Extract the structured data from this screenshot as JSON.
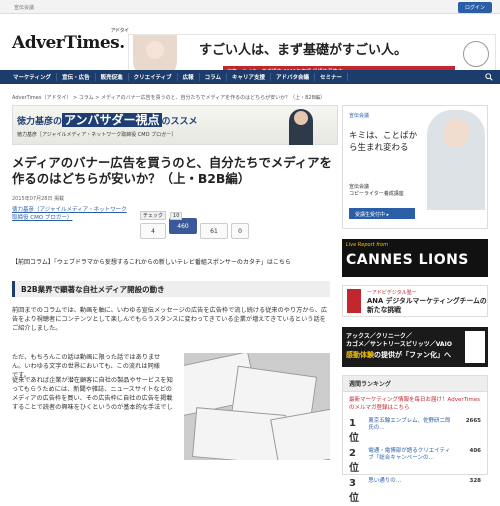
{
  "top": {
    "site": "宣伝会議",
    "login": "ログイン"
  },
  "header": {
    "logo": "AdverTimes.",
    "logo_ruby": "アドタイ"
  },
  "banner": {
    "catch": "すごい人は、まず基礎がすごい人。",
    "sub": "編集・ライター養成講座 2015年春期 受講生募集中"
  },
  "nav": [
    "マーケティング",
    "宣伝・広告",
    "販売促進",
    "クリエイティブ",
    "広報",
    "コラム",
    "キャリア支援",
    "アドバタ会議",
    "セミナー"
  ],
  "breadcrumb": "AdverTimes（アドタイ） > コラム > メディアのバナー広告を買うのと、自分たちでメディアを作るのはどちらが安いか？（上・B2B編）",
  "series_banner": {
    "title_a": "徳力基彦の",
    "title_em": "アンバサダー視点",
    "title_b": "のススメ",
    "sub": "徳力基彦［アジャイルメディア・ネットワーク取締役 CMO ブロガー］"
  },
  "article": {
    "title": "メディアのバナー広告を買うのと、自分たちでメディアを作るのはどちらが安いか？（上・B2B編）",
    "date": "2015年07月28日 掲載",
    "author_line1": "徳力基彦（アジャイルメディア・ネットワーク",
    "author_line2": "取締役 CMO ブロガー）",
    "column": "【前回コラム】「ウェブドラマから妄想するこれからの新しいテレビ番組スポンサーのカタチ」はこちら",
    "section": "B2B業界で顕著な自社メディア開設の動き",
    "p1": "前回までのコラムでは、動画を軸に、いわゆる宣伝メッセージの広告を広告枠で流し続ける従来のやり方から、広告をより視聴者にコンテンツとして楽しんでもらうスタンスに変わってきている企業が増えてきているという話をご紹介しました。",
    "p2": "ただ、もちろんこの話は動画に限った話ではありません。いわゆる文字の世界においても、この流れは同様です。",
    "p3": "従来であれば企業が潜在顧客に自社の製品やサービスを知ってもらうためには、新聞や雑誌、ニュースサイトなどのメディアの広告枠を買い、その広告枠に自社の広告を掲載することで読者の興味をひくというのが基本的な手法でし"
  },
  "social": {
    "check": "チェック",
    "count_a": "10",
    "count_b": "4",
    "count_like": "460",
    "count_c": "61",
    "gplus": "0",
    "like": "いいね！"
  },
  "ad1": {
    "brand": "宣伝会議",
    "text": "キミは、ことばから生まれ変わる",
    "org": "宣伝会議",
    "course": "コピーライター養成講座",
    "btn": "受講生受付中 ▸"
  },
  "cannes": {
    "label": "Live Report from",
    "title": "CANNES LIONS"
  },
  "ana": {
    "tag": "ーアドビデジタル塾ー",
    "title": "ANA デジタルマーケティングチームの新たな挑戦"
  },
  "aw": {
    "t1": "アックス／クリニーク／",
    "t2": "カゴメ／サントリースピリッツ／VAIO",
    "t3a": "感動体験",
    "t3b": "の提供が「ファン化」へ"
  },
  "ranking": {
    "header": "週間ランキング",
    "promo": "最新マーケティング情報を毎日お届け！AdverTimesのメルマガ登録はこちら",
    "rows": [
      {
        "rank": "1位",
        "text": "東京五輪エンブレム、佐野研二郎氏の…",
        "count": "2665"
      },
      {
        "rank": "2位",
        "text": "電通・電博部が語るクリエイティブ「総合キャンペーンの…",
        "count": "406"
      },
      {
        "rank": "3位",
        "text": "思い通りの…",
        "count": "328"
      }
    ]
  }
}
